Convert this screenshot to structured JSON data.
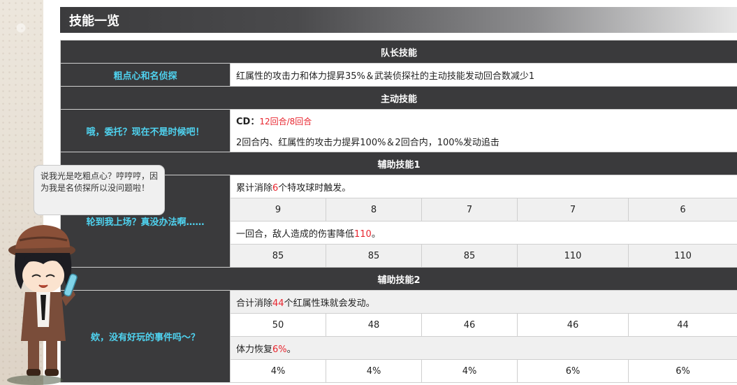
{
  "section": {
    "title": "技能一览"
  },
  "leader": {
    "category": "队长技能",
    "name": "粗点心和名侦探",
    "desc": "红属性的攻击力和体力提昇35%＆武装侦探社的主动技能发动回合数减少1"
  },
  "active": {
    "category": "主动技能",
    "name": "哦，委托？现在不是时候吧！",
    "cd_label": "CD：",
    "cd_value": "12回合/8回合",
    "desc": "2回合内、红属性的攻击力提昇100%＆2回合内，100%发动追击"
  },
  "support1": {
    "category": "辅助技能1",
    "name": "轮到我上场？真没办法啊……",
    "cond_pre": "累计消除",
    "cond_num": "6",
    "cond_post": "个特攻球时触发。",
    "cond_values": [
      "9",
      "8",
      "7",
      "7",
      "6"
    ],
    "effect_pre": "一回合，敌人造成的伤害降低",
    "effect_num": "110",
    "effect_post": "。",
    "effect_values": [
      "85",
      "85",
      "85",
      "110",
      "110"
    ]
  },
  "support2": {
    "category": "辅助技能2",
    "name": "欸，没有好玩的事件吗～？",
    "cond_pre": "合计消除",
    "cond_num": "44",
    "cond_post": "个红属性珠就会发动。",
    "cond_values": [
      "50",
      "48",
      "46",
      "46",
      "44"
    ],
    "effect_pre": "体力恢复",
    "effect_num": "6%",
    "effect_post": "。",
    "effect_values": [
      "4%",
      "4%",
      "4%",
      "6%",
      "6%"
    ]
  },
  "tooltip": {
    "text": "说我光是吃粗点心？哼哼哼，因为我是名侦探所以没问题啦！"
  },
  "colors": {
    "header_dark": "#3a3a3c",
    "name_cyan": "#4fd3f0",
    "highlight_red": "#e8262f",
    "row_grey": "#f0f0f0"
  }
}
